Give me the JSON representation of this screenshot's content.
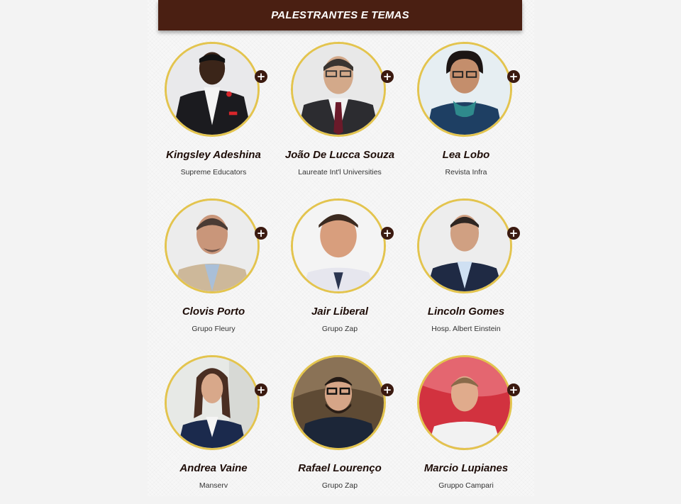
{
  "header": {
    "title": "PALESTRANTES E TEMAS"
  },
  "speakers": [
    {
      "name": "Kingsley Adeshina",
      "company": "Supreme Educators"
    },
    {
      "name": "João De Lucca Souza",
      "company": "Laureate Int'l Universities"
    },
    {
      "name": "Lea Lobo",
      "company": "Revista Infra"
    },
    {
      "name": "Clovis Porto",
      "company": "Grupo Fleury"
    },
    {
      "name": "Jair Liberal",
      "company": "Grupo Zap"
    },
    {
      "name": "Lincoln Gomes",
      "company": "Hosp. Albert Einstein"
    },
    {
      "name": "Andrea Vaine",
      "company": "Manserv"
    },
    {
      "name": "Rafael Lourenço",
      "company": "Grupo Zap"
    },
    {
      "name": "Marcio Lupianes",
      "company": "Gruppo Campari"
    }
  ],
  "expand_label": "+",
  "colors": {
    "header_bg": "#4a1f12",
    "avatar_ring": "#e3c44e",
    "plus_button": "#3b1a10"
  }
}
